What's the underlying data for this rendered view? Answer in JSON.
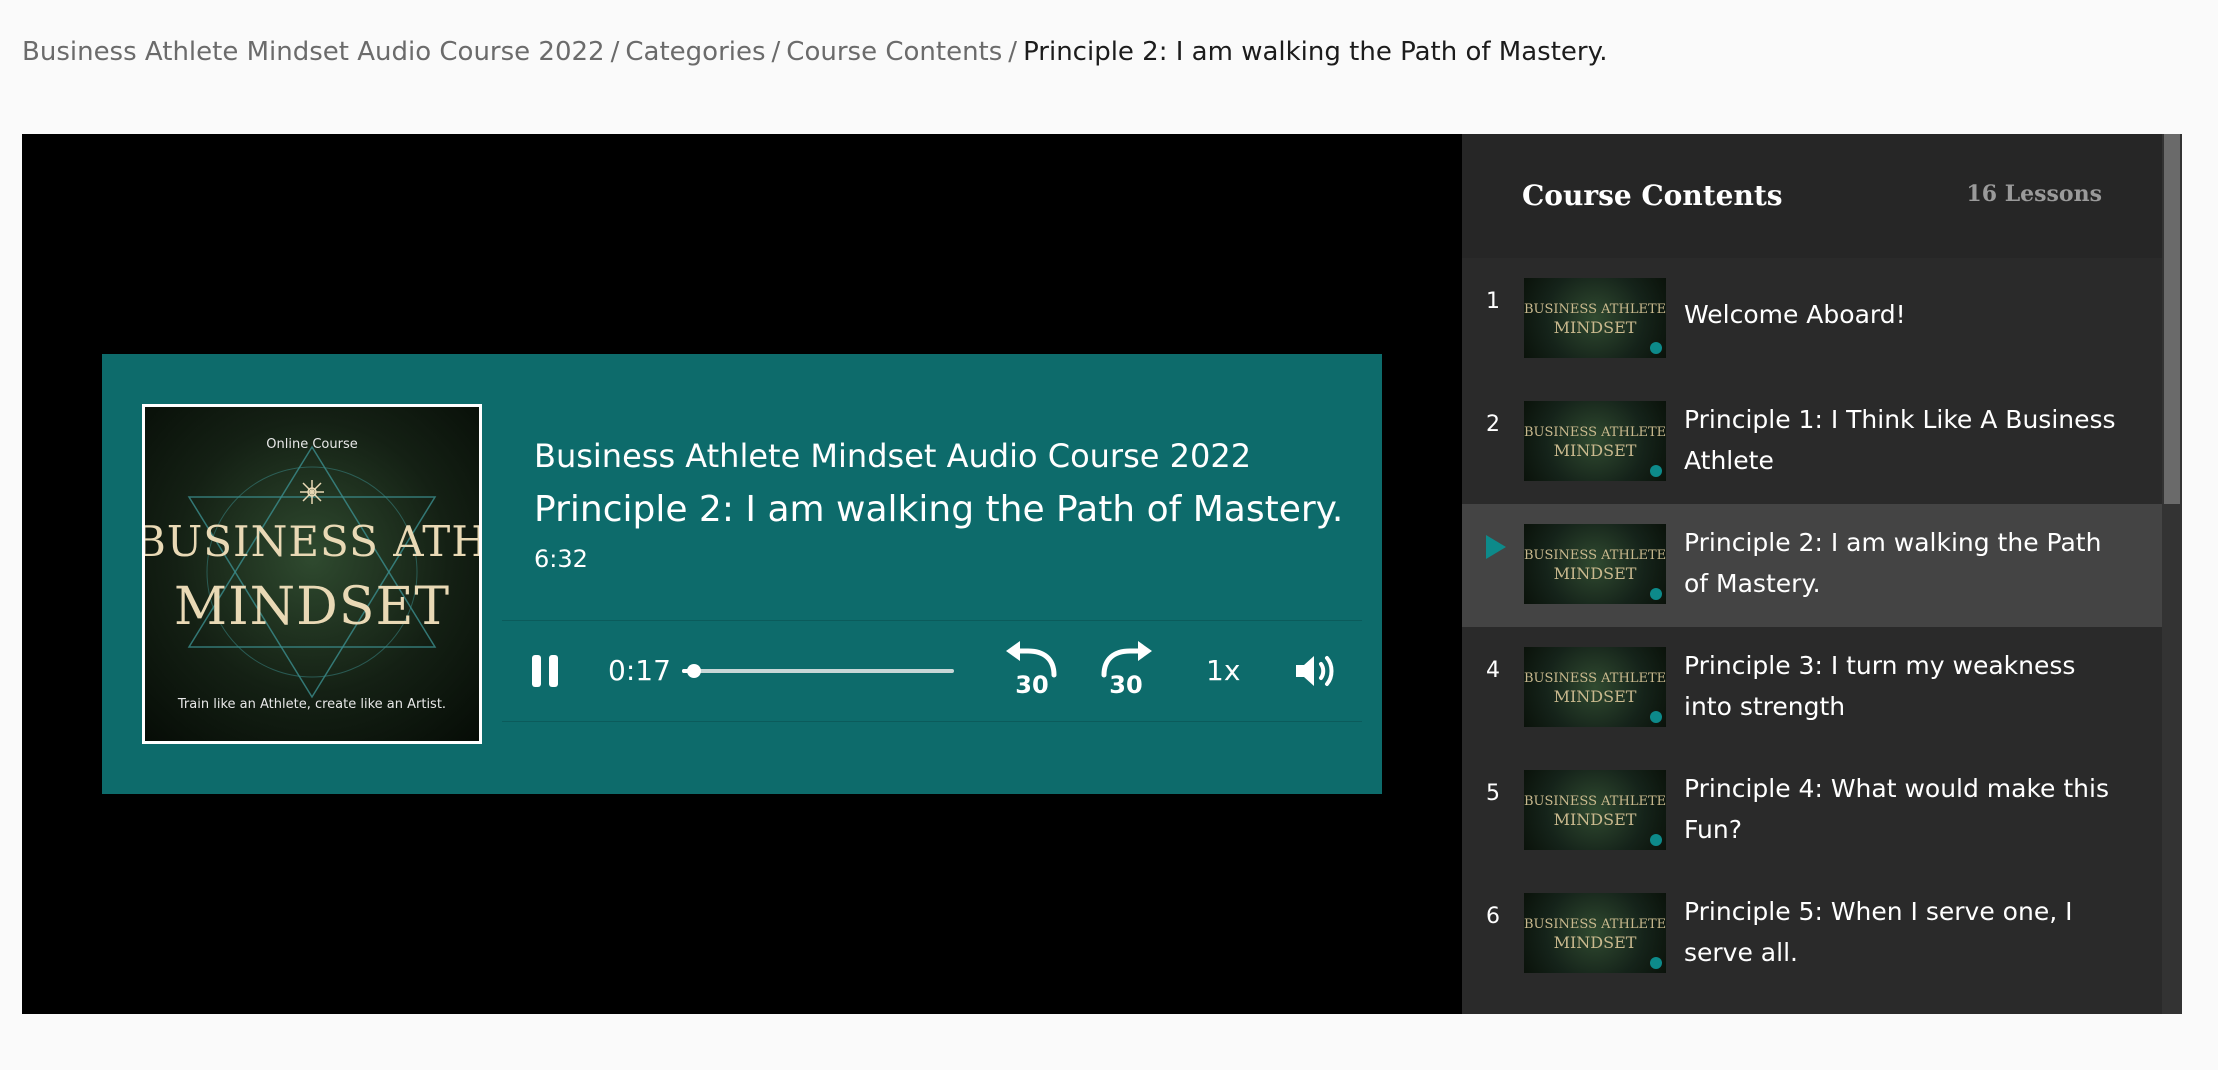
{
  "breadcrumb": {
    "items": [
      "Business Athlete Mindset Audio Course 2022",
      "Categories",
      "Course Contents"
    ],
    "separator": "/",
    "current": "Principle 2: I am walking the Path of Mastery."
  },
  "player": {
    "cover": {
      "small_label": "Online Course",
      "title_line1": "BUSINESS ATHLETE",
      "title_line2": "MINDSET",
      "tagline": "Train like an Athlete, create like an Artist."
    },
    "course_name": "Business Athlete Mindset Audio Course 2022",
    "lesson_name": "Principle 2: I am walking the Path of Mastery.",
    "duration": "6:32",
    "elapsed": "0:17",
    "progress_fraction": 0.043,
    "rewind_seconds": "30",
    "forward_seconds": "30",
    "speed": "1x",
    "accent_color": "#0d6b6b"
  },
  "sidebar": {
    "title": "Course Contents",
    "lesson_count": "16 Lessons",
    "thumb": {
      "line1": "BUSINESS ATHLETE",
      "line2": "MINDSET"
    },
    "lessons": [
      {
        "number": "1",
        "title": "Welcome Aboard!"
      },
      {
        "number": "2",
        "title": "Principle 1: I Think Like A Business Athlete"
      },
      {
        "number": "3",
        "title": "Principle 2: I am walking the Path of Mastery."
      },
      {
        "number": "4",
        "title": "Principle 3: I turn my weakness into strength"
      },
      {
        "number": "5",
        "title": "Principle 4: What would make this Fun?"
      },
      {
        "number": "6",
        "title": "Principle 5: When I serve one, I serve all."
      }
    ]
  }
}
